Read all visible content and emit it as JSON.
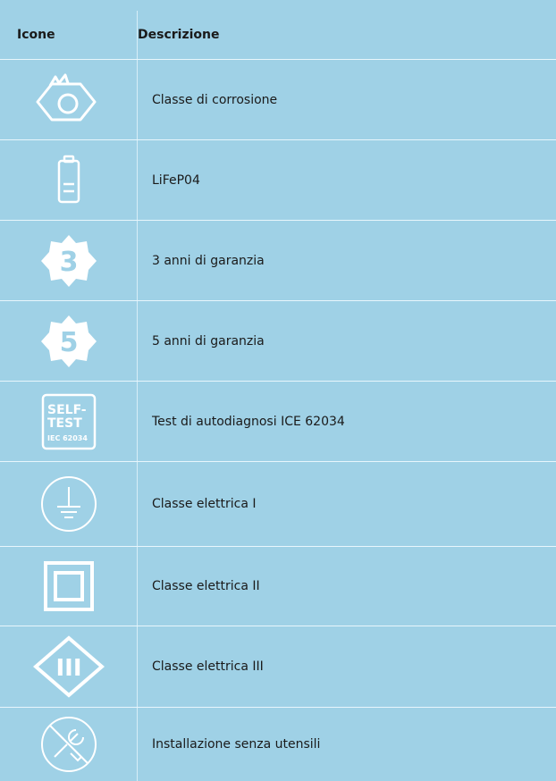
{
  "header": {
    "col_icons": "Icone",
    "col_description": "Descrizione"
  },
  "rows": [
    {
      "icon": "corrosion-class-icon",
      "label": "Classe di corrosione"
    },
    {
      "icon": "battery-icon",
      "label": "LiFeP04"
    },
    {
      "icon": "warranty-3-years-icon",
      "label": "3 anni di garanzia",
      "badge": "3"
    },
    {
      "icon": "warranty-5-years-icon",
      "label": "5 anni di garanzia",
      "badge": "5"
    },
    {
      "icon": "self-test-icon",
      "label": "Test di autodiagnosi ICE 62034",
      "badge_lines": [
        "SELF-",
        "TEST",
        "IEC 62034"
      ]
    },
    {
      "icon": "electrical-class-1-icon",
      "label": "Classe elettrica I"
    },
    {
      "icon": "electrical-class-2-icon",
      "label": "Classe elettrica II"
    },
    {
      "icon": "electrical-class-3-icon",
      "label": "Classe elettrica III",
      "badge": "III"
    },
    {
      "icon": "tool-free-installation-icon",
      "label": "Installazione senza utensili"
    }
  ],
  "colors": {
    "background": "#9fd1e6",
    "icon_stroke": "#ffffff",
    "divider": "#e8f6fc"
  }
}
